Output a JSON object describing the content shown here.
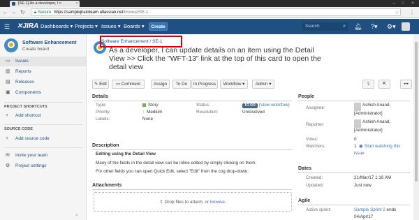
{
  "browser": {
    "tab_title": "[SE-1] As a developer, I c",
    "secure_label": "Secure",
    "url_host": "https://samplejiratoteam.atlassian.net",
    "url_path": "/browse/SE-1"
  },
  "header": {
    "logo": "JIRA",
    "nav": [
      "Dashboards ▾",
      "Projects ▾",
      "Issues ▾",
      "Boards ▾"
    ],
    "create_label": "Create",
    "search_placeholder": "Search"
  },
  "sidebar": {
    "project_name": "Software Enhancement",
    "project_sub": "Create board",
    "items": [
      {
        "label": "Issues",
        "icon": "issues-icon",
        "active": true
      },
      {
        "label": "Reports",
        "icon": "reports-icon",
        "active": false
      },
      {
        "label": "Releases",
        "icon": "releases-icon",
        "active": false
      },
      {
        "label": "Components",
        "icon": "components-icon",
        "active": false
      }
    ],
    "shortcuts_header": "PROJECT SHORTCUTS",
    "add_shortcut": "Add shortcut",
    "source_header": "SOURCE CODE",
    "add_source": "Add source code",
    "invite": "Invite your team",
    "settings": "Project settings"
  },
  "issue": {
    "breadcrumb_project": "Software Enhancement",
    "breadcrumb_sep": "/",
    "breadcrumb_key": "SE-1",
    "summary": "As a developer, I can update details on an item using the Detail View >> Click the \"WFT-13\" link at the top of this card to open the detail view",
    "toolbar": {
      "edit": "Edit",
      "comment": "Comment",
      "assign": "Assign",
      "todo": "To Do",
      "inprogress": "In Progress",
      "workflow": "Workflow ▾",
      "admin": "Admin ▾"
    },
    "details": {
      "header": "Details",
      "type_label": "Type:",
      "type_value": "Story",
      "priority_label": "Priority:",
      "priority_value": "Medium",
      "labels_label": "Labels:",
      "labels_value": "None",
      "status_label": "Status:",
      "status_value": "TO DO",
      "view_workflow": "(View workflow)",
      "resolution_label": "Resolution:",
      "resolution_value": "Unresolved"
    },
    "description": {
      "header": "Description",
      "title": "Editing using the Detail View",
      "line1": "Many of the fields in the detail view can be inline edited by simply clicking on them.",
      "line2": "For other fields you can open Quick Edit, select \"Edit\" from the cog drop-down."
    },
    "attachments": {
      "header": "Attachments",
      "drop_text": "Drop files to attach, or ",
      "browse": "browse."
    },
    "people": {
      "header": "People",
      "assignee_label": "Assignee:",
      "assignee_name": "Ashish Anand,",
      "assignee_role": "[Administrator]",
      "reporter_label": "Reporter:",
      "reporter_name": "Ashish Anand,",
      "reporter_role": "[Administrator]",
      "votes_label": "Votes:",
      "votes_value": "0",
      "watchers_label": "Watchers:",
      "watchers_value": "1",
      "watch_link": "Start watching this",
      "watch_link2": "issue"
    },
    "dates": {
      "header": "Dates",
      "created_label": "Created:",
      "created_value": "21/Mar/17 1:16 AM",
      "updated_label": "Updated:",
      "updated_value": "Just now"
    },
    "agile": {
      "header": "Agile",
      "sprint_label": "Active sprint:",
      "sprint_value": "Sample Sprint 2",
      "sprint_ends": " ends",
      "sprint_date": "04/Apr/17"
    }
  },
  "colors": {
    "header": "#205081",
    "link": "#3b73af",
    "highlight": "#dd0000"
  }
}
